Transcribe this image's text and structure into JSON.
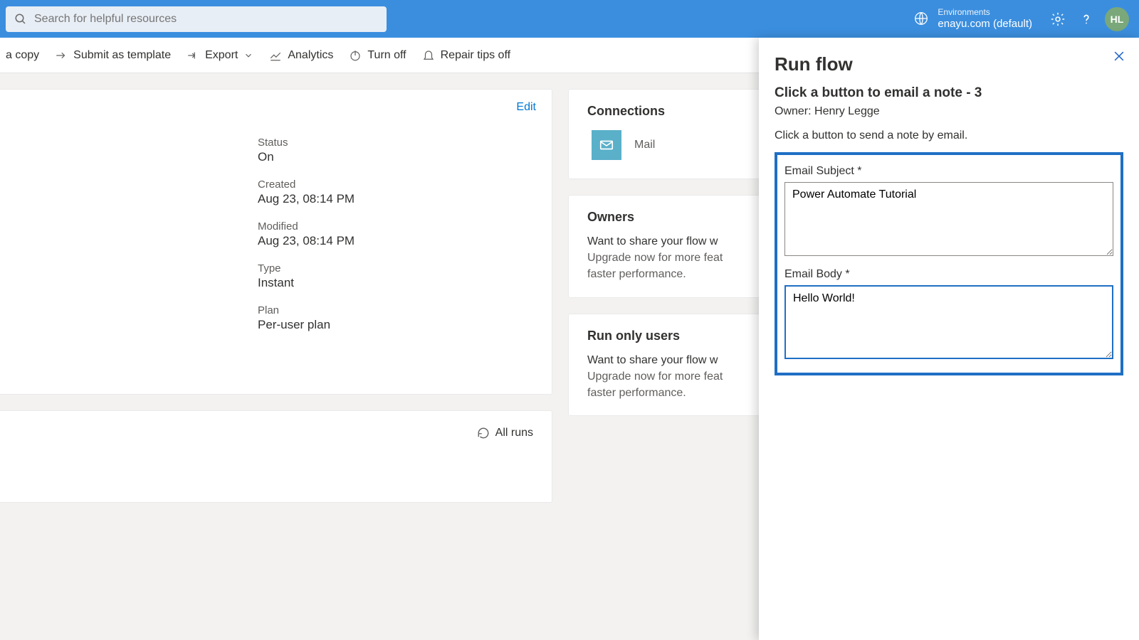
{
  "header": {
    "search_placeholder": "Search for helpful resources",
    "env_label": "Environments",
    "env_value": "enayu.com (default)",
    "avatar": "HL"
  },
  "cmdbar": {
    "copy": "a copy",
    "submit": "Submit as template",
    "export": "Export",
    "analytics": "Analytics",
    "turnoff": "Turn off",
    "repair": "Repair tips off"
  },
  "details": {
    "edit": "Edit",
    "status_k": "Status",
    "status_v": "On",
    "created_k": "Created",
    "created_v": "Aug 23, 08:14 PM",
    "modified_k": "Modified",
    "modified_v": "Aug 23, 08:14 PM",
    "type_k": "Type",
    "type_v": "Instant",
    "plan_k": "Plan",
    "plan_v": "Per-user plan"
  },
  "runs": {
    "all_runs": "All runs"
  },
  "connections": {
    "title": "Connections",
    "mail": "Mail"
  },
  "owners": {
    "title": "Owners",
    "lead": "Want to share your flow w",
    "line2": "Upgrade now for more feat",
    "line3": "faster performance."
  },
  "runonly": {
    "title": "Run only users",
    "lead": "Want to share your flow w",
    "line2": "Upgrade now for more feat",
    "line3": "faster performance."
  },
  "panel": {
    "title": "Run flow",
    "flow_name": "Click a button to email a note - 3",
    "owner": "Owner: Henry Legge",
    "desc": "Click a button to send a note by email.",
    "subject_label": "Email Subject *",
    "subject_value": "Power Automate Tutorial",
    "body_label": "Email Body *",
    "body_value": "Hello World!"
  }
}
